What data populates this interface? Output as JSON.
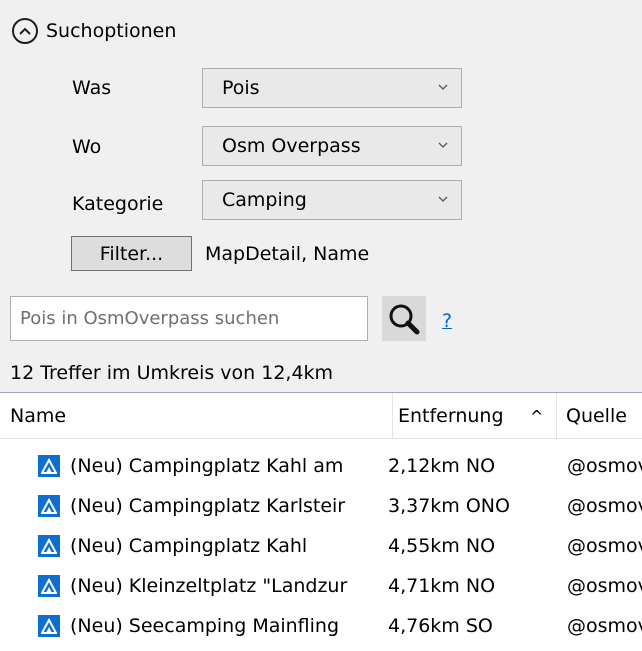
{
  "search_options": {
    "title": "Suchoptionen",
    "was_label": "Was",
    "was_value": "Pois",
    "wo_label": "Wo",
    "wo_value": "Osm Overpass",
    "kategorie_label": "Kategorie",
    "kategorie_value": "Camping",
    "filter_button": "Filter...",
    "filter_text": "MapDetail, Name",
    "search_placeholder": "Pois in OsmOverpass suchen",
    "help_link": "?",
    "result_count": "12 Treffer im Umkreis von 12,4km"
  },
  "icons": {
    "collapse": "chevron-up-icon",
    "dropdown": "chevron-down-icon",
    "search": "magnifier-icon",
    "poi": "tent-icon"
  },
  "colors": {
    "panel_bg": "#f0f0f0",
    "poi_icon_bg": "#0f6fd1",
    "link": "#0066cc"
  },
  "table": {
    "columns": [
      "Name",
      "Entfernung",
      "Quelle"
    ],
    "sort_indicator": "^",
    "rows": [
      {
        "name": "(Neu) Campingplatz Kahl am",
        "distance": "2,12km NO",
        "source": "@osmov"
      },
      {
        "name": "(Neu) Campingplatz Karlsteir",
        "distance": "3,37km ONO",
        "source": "@osmov"
      },
      {
        "name": "(Neu) Campingplatz Kahl",
        "distance": "4,55km NO",
        "source": "@osmov"
      },
      {
        "name": "(Neu) Kleinzeltplatz \"Landzur",
        "distance": "4,71km NO",
        "source": "@osmov"
      },
      {
        "name": "(Neu) Seecamping Mainfling",
        "distance": "4,76km SO",
        "source": "@osmov"
      }
    ]
  }
}
